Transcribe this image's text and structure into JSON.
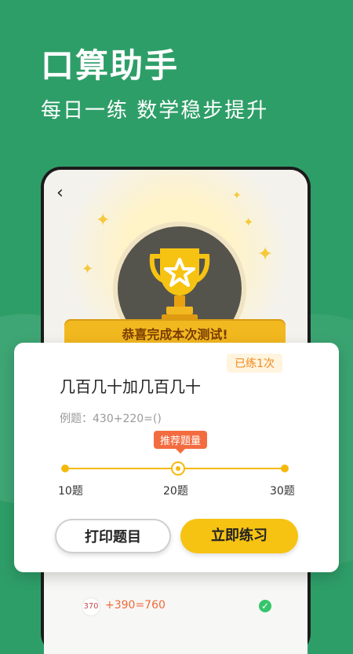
{
  "promo": {
    "headline": "口算助手",
    "subheadline": "每日一练  数学稳步提升"
  },
  "phone": {
    "banner_text": "恭喜完成本次测试!",
    "list_item_text": "+390=760",
    "icons": {
      "back": "back-chevron-icon",
      "trophy": "trophy-icon",
      "sparkle": "sparkle-icon",
      "check": "check-icon"
    }
  },
  "sheet": {
    "badge": "已练1次",
    "title": "几百几十加几百几十",
    "example": "例题：430+220=()",
    "tooltip": "推荐题量",
    "slider": {
      "labels": [
        "10题",
        "20题",
        "30题"
      ],
      "selected_index": 1
    },
    "buttons": {
      "print": "打印题目",
      "practice": "立即练习"
    }
  },
  "colors": {
    "green_bg": "#2e9e68",
    "accent_yellow": "#f6c313",
    "tooltip_orange": "#f36c40"
  }
}
